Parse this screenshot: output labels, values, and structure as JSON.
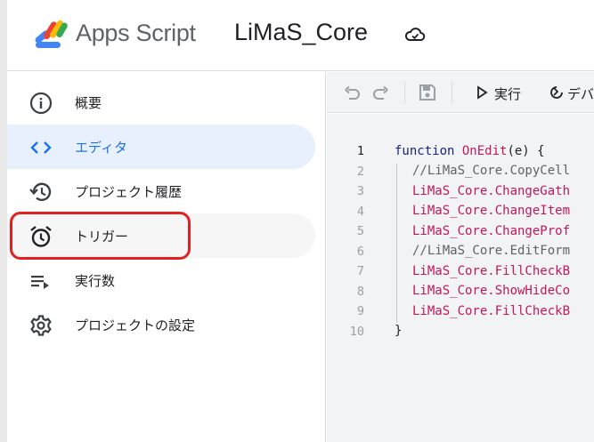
{
  "header": {
    "app_name": "Apps Script",
    "project_name": "LiMaS_Core"
  },
  "sidebar": {
    "items": [
      {
        "label": "概要",
        "icon": "info-icon"
      },
      {
        "label": "エディタ",
        "icon": "code-icon"
      },
      {
        "label": "プロジェクト履歴",
        "icon": "history-icon"
      },
      {
        "label": "トリガー",
        "icon": "alarm-clock-icon"
      },
      {
        "label": "実行数",
        "icon": "executions-icon"
      },
      {
        "label": "プロジェクトの設定",
        "icon": "gear-icon"
      }
    ],
    "active_index": 1
  },
  "toolbar": {
    "run_label": "実行",
    "debug_label": "デバ"
  },
  "editor": {
    "line_numbers": [
      "1",
      "2",
      "3",
      "4",
      "5",
      "6",
      "7",
      "8",
      "9",
      "10"
    ],
    "lines": [
      {
        "kw": "function ",
        "fn": "OnEdit",
        "rest": "(e) {"
      },
      {
        "cm": "//LiMaS_Core.CopyCell"
      },
      {
        "fn": "LiMaS_Core.ChangeGath"
      },
      {
        "fn": "LiMaS_Core.ChangeItem"
      },
      {
        "fn": "LiMaS_Core.ChangeProf"
      },
      {
        "cm": "//LiMaS_Core.EditForm"
      },
      {
        "fn": "LiMaS_Core.FillCheckB"
      },
      {
        "fn": "LiMaS_Core.ShowHideCo"
      },
      {
        "fn": "LiMaS_Core.FillCheckB"
      },
      {
        "rest": "}"
      }
    ]
  },
  "colors": {
    "accent": "#1a73e8",
    "active_bg": "#e8f0fe",
    "annotation_red": "#e1201f",
    "code_fn": "#c2185b",
    "code_kw": "#1a237e"
  }
}
